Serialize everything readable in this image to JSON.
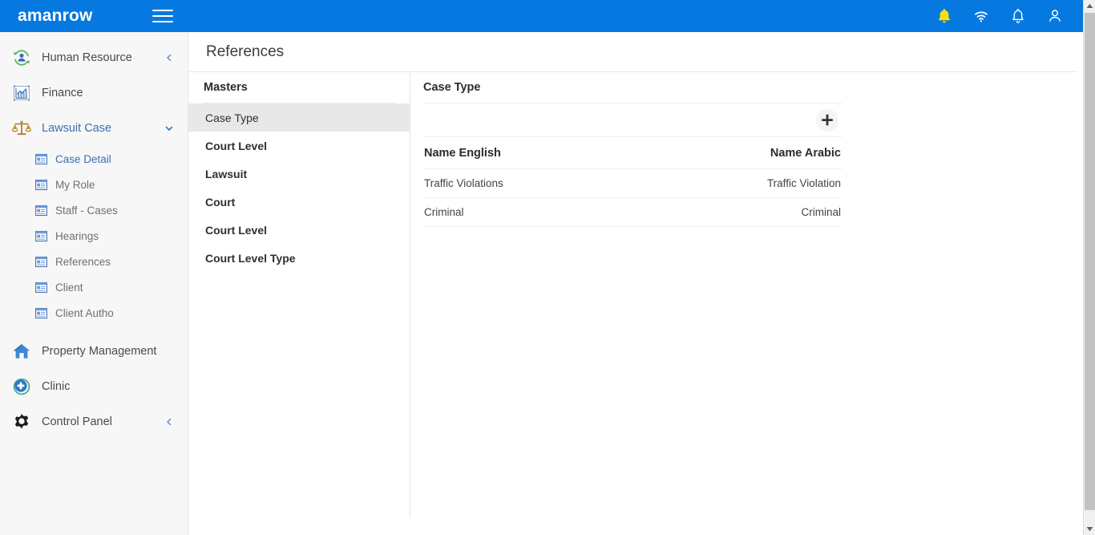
{
  "topbar": {
    "brand": "amanrow",
    "menu_icon": "hamburger-icon",
    "background": "#0579e0",
    "icons": [
      {
        "name": "alert-bell-icon",
        "glyph": "bell-filled",
        "color": "#ffe000"
      },
      {
        "name": "wifi-icon",
        "glyph": "wifi",
        "color": "#ffffff"
      },
      {
        "name": "notification-bell-icon",
        "glyph": "bell-outline",
        "color": "#ffffff"
      },
      {
        "name": "user-account-icon",
        "glyph": "user",
        "color": "#ffffff"
      }
    ]
  },
  "sidebar": {
    "items": [
      {
        "label": "Human Resource",
        "icon": "user-refresh-icon",
        "chevron": "left",
        "expanded": false
      },
      {
        "label": "Finance",
        "icon": "chart-icon",
        "chevron": "none",
        "expanded": false
      },
      {
        "label": "Lawsuit Case",
        "icon": "scales-icon",
        "chevron": "down",
        "expanded": true,
        "active": true
      }
    ],
    "sub_items": [
      {
        "label": "Case Detail",
        "icon": "form-window-icon",
        "active": true
      },
      {
        "label": "My Role",
        "icon": "form-window-icon",
        "active": false
      },
      {
        "label": "Staff - Cases",
        "icon": "form-window-icon",
        "active": false
      },
      {
        "label": "Hearings",
        "icon": "form-window-icon",
        "active": false
      },
      {
        "label": "References",
        "icon": "form-window-icon",
        "active": false
      },
      {
        "label": "Client",
        "icon": "form-window-icon",
        "active": false
      },
      {
        "label": "Client Autho",
        "icon": "form-window-icon",
        "active": false
      }
    ],
    "bottom_items": [
      {
        "label": "Property Management",
        "icon": "home-icon",
        "chevron": "none"
      },
      {
        "label": "Clinic",
        "icon": "medical-cross-icon",
        "chevron": "none"
      },
      {
        "label": "Control Panel",
        "icon": "gear-icon",
        "chevron": "left"
      }
    ]
  },
  "page": {
    "title": "References"
  },
  "masters": {
    "title": "Masters",
    "items": [
      {
        "label": "Case Type",
        "selected": true
      },
      {
        "label": "Court Level",
        "selected": false
      },
      {
        "label": "Lawsuit",
        "selected": false
      },
      {
        "label": "Court",
        "selected": false
      },
      {
        "label": "Court Level",
        "selected": false
      },
      {
        "label": "Court Level Type",
        "selected": false
      }
    ]
  },
  "content": {
    "title": "Case Type",
    "add_button": "add-icon",
    "table": {
      "columns": [
        "Name English",
        "Name Arabic"
      ],
      "rows": [
        [
          "Traffic Violations",
          "Traffic Violation"
        ],
        [
          "Criminal",
          "Criminal"
        ]
      ]
    }
  },
  "scrollbar": {
    "up_arrow": "chevron-up-icon",
    "down_arrow": "chevron-down-icon"
  }
}
